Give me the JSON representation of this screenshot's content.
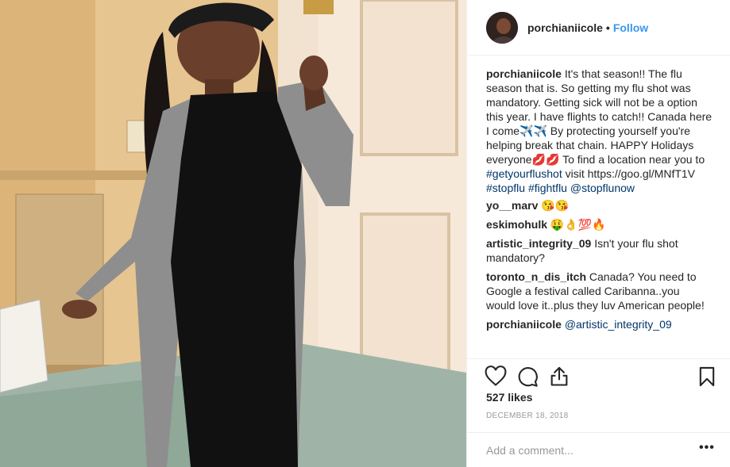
{
  "post": {
    "username": "porchianiicole",
    "dot": "•",
    "follow_label": "Follow",
    "caption": {
      "username": "porchianiicole",
      "text_1": "It's that season!! The flu season that is. So getting my flu shot was mandatory. Getting sick will not be a option this year. I have flights to catch!! Canada here I come✈️✈️ By protecting yourself you're helping break that chain. HAPPY Holidays everyone💋💋 To find a location near you to ",
      "tag_1": "#getyourflushot",
      "text_2": " visit https://goo.gl/MNfT1V ",
      "tag_2": "#stopflu",
      "text_3": " ",
      "tag_3": "#fightflu",
      "text_4": " ",
      "mention": "@stopflunow"
    },
    "comments": [
      {
        "username": "yo__marv",
        "text": "😘😘"
      },
      {
        "username": "eskimohulk",
        "text": "🤑👌💯🔥"
      },
      {
        "username": "artistic_integrity_09",
        "text": "Isn't your flu shot mandatory?"
      },
      {
        "username": "toronto_n_dis_itch",
        "text": "Canada? You need to Google a festival called Caribanna..you would love it..plus they luv American people!"
      },
      {
        "username": "porchianiicole",
        "text": "@artistic_integrity_09"
      }
    ],
    "likes": "527 likes",
    "date": "DECEMBER 18, 2018",
    "add_comment_placeholder": "Add a comment...",
    "more_label": "•••",
    "icons": {
      "like": "heart-icon",
      "comment": "comment-icon",
      "share": "share-icon",
      "save": "bookmark-icon",
      "more": "more-options-icon"
    },
    "colors": {
      "link": "#3897f0",
      "text": "#262626",
      "muted": "#999999",
      "border": "#efefef"
    }
  }
}
